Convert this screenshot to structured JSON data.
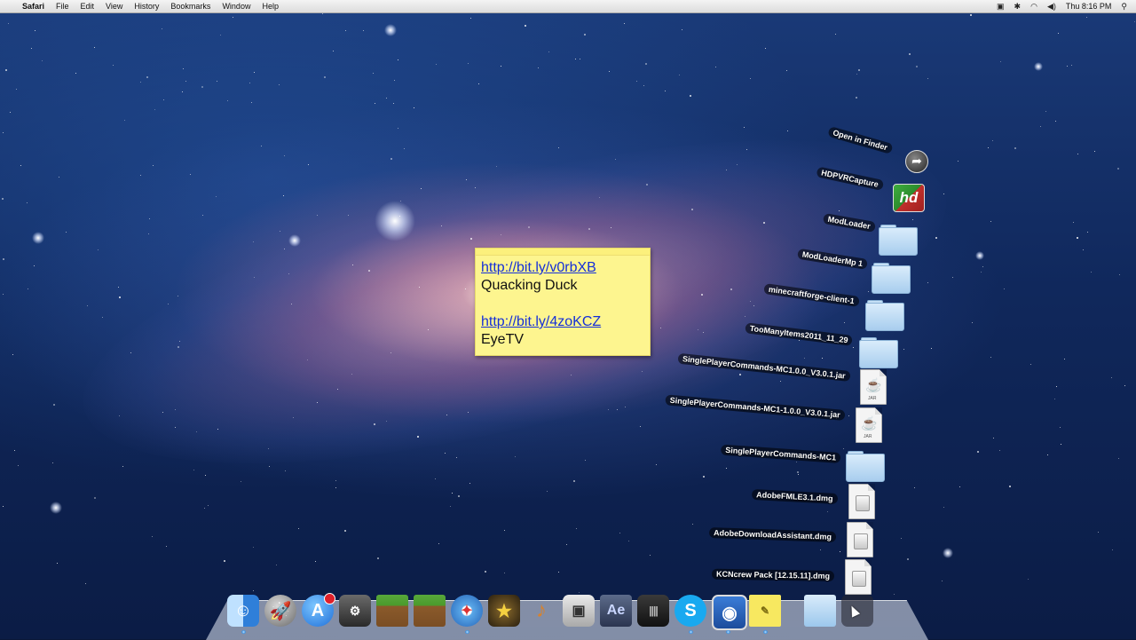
{
  "menubar": {
    "apple": "",
    "app_name": "Safari",
    "menus": [
      "File",
      "Edit",
      "View",
      "History",
      "Bookmarks",
      "Window",
      "Help"
    ],
    "status_icons": [
      "screen-record-icon",
      "bluetooth-icon",
      "wifi-icon",
      "volume-icon"
    ],
    "clock": "Thu 8:16 PM",
    "spotlight_icon": "search-icon"
  },
  "sticky_note": {
    "link1": "http://bit.ly/v0rbXB",
    "line1": "Quacking Duck",
    "link2": "http://bit.ly/4zoKCZ",
    "line2": "EyeTV"
  },
  "stack_fan": {
    "items": [
      {
        "label": "Open in Finder",
        "icon": "open-arrow-icon"
      },
      {
        "label": "HDPVRCapture",
        "icon": "hd-app-icon"
      },
      {
        "label": "ModLoader",
        "icon": "folder-icon"
      },
      {
        "label": "ModLoaderMp 1",
        "icon": "folder-icon"
      },
      {
        "label": "minecraftforge-client-1",
        "icon": "folder-icon"
      },
      {
        "label": "TooManyItems2011_11_29",
        "icon": "folder-icon"
      },
      {
        "label": "SinglePlayerCommands-MC1.0.0_V3.0.1.jar",
        "icon": "jar-file-icon"
      },
      {
        "label": "SinglePlayerCommands-MC1-1.0.0_V3.0.1.jar",
        "icon": "jar-file-icon"
      },
      {
        "label": "SinglePlayerCommands-MC1",
        "icon": "folder-icon"
      },
      {
        "label": "AdobeFMLE3.1.dmg",
        "icon": "dmg-file-icon"
      },
      {
        "label": "AdobeDownloadAssistant.dmg",
        "icon": "dmg-file-icon"
      },
      {
        "label": "KCNcrew Pack [12.15.11].dmg",
        "icon": "dmg-file-icon"
      }
    ],
    "jar_text": "JAR"
  },
  "dock": {
    "items": [
      {
        "name": "finder",
        "glyph": "☺"
      },
      {
        "name": "launchpad",
        "glyph": "🚀"
      },
      {
        "name": "app-store",
        "glyph": "A"
      },
      {
        "name": "steam",
        "glyph": "⚙"
      },
      {
        "name": "minecraft",
        "glyph": ""
      },
      {
        "name": "minecraft-alt",
        "glyph": ""
      },
      {
        "name": "safari",
        "glyph": "✦"
      },
      {
        "name": "imovie",
        "glyph": "★"
      },
      {
        "name": "garageband",
        "glyph": "♪"
      },
      {
        "name": "photo-booth",
        "glyph": "▣"
      },
      {
        "name": "after-effects",
        "glyph": "Ae"
      },
      {
        "name": "mixer",
        "glyph": "||||"
      },
      {
        "name": "skype",
        "glyph": "S"
      },
      {
        "name": "preview",
        "glyph": "◉"
      },
      {
        "name": "stickies",
        "glyph": "✎"
      },
      {
        "name": "downloads-folder",
        "glyph": ""
      },
      {
        "name": "stack",
        "glyph": ""
      },
      {
        "name": "trash",
        "glyph": ""
      }
    ]
  }
}
